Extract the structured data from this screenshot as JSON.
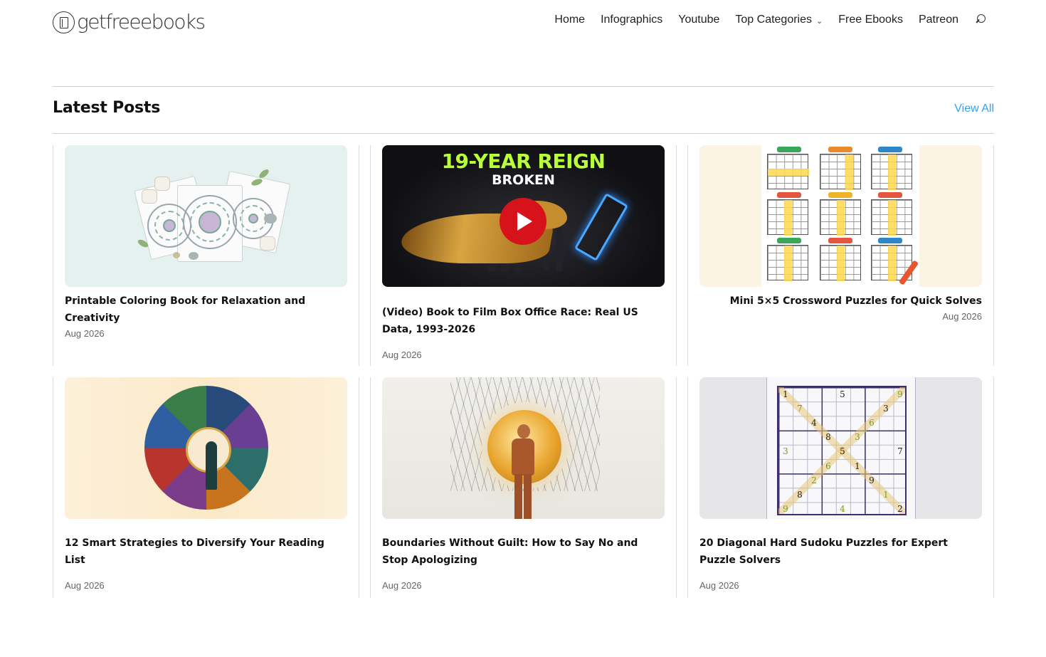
{
  "brand": {
    "logo_text": "getfreeebooks"
  },
  "nav": {
    "items": [
      {
        "label": "Home"
      },
      {
        "label": "Infographics"
      },
      {
        "label": "Youtube"
      },
      {
        "label": "Top Categories",
        "has_dropdown": true
      },
      {
        "label": "Free Ebooks"
      },
      {
        "label": "Patreon"
      }
    ],
    "search_icon": "search-icon"
  },
  "section": {
    "title": "Latest Posts",
    "view_all": "View All"
  },
  "colors": {
    "link": "#2ea3f2",
    "play_button": "#d6131a"
  },
  "posts": [
    {
      "title": "Printable Coloring Book for Relaxation and Creativity",
      "date": "Aug 2026",
      "align": "left"
    },
    {
      "title": "(Video) Book to Film Box Office Race: Real US Data, 1993-2026",
      "date": "Aug 2026",
      "align": "left",
      "thumb_text": {
        "line1": "19-YEAR REIGN",
        "line2": "BROKEN"
      },
      "is_video": true
    },
    {
      "title": "Mini 5×5 Crossword Puzzles for Quick Solves",
      "date": "Aug 2026",
      "align": "right"
    },
    {
      "title": "12 Smart Strategies to Diversify Your Reading List",
      "date": "Aug 2026",
      "align": "left"
    },
    {
      "title": "Boundaries Without Guilt: How to Say No and Stop Apologizing",
      "date": "Aug 2026",
      "align": "left"
    },
    {
      "title": "20 Diagonal Hard Sudoku Puzzles for Expert Puzzle Solvers",
      "date": "Aug 2026",
      "align": "left"
    }
  ]
}
